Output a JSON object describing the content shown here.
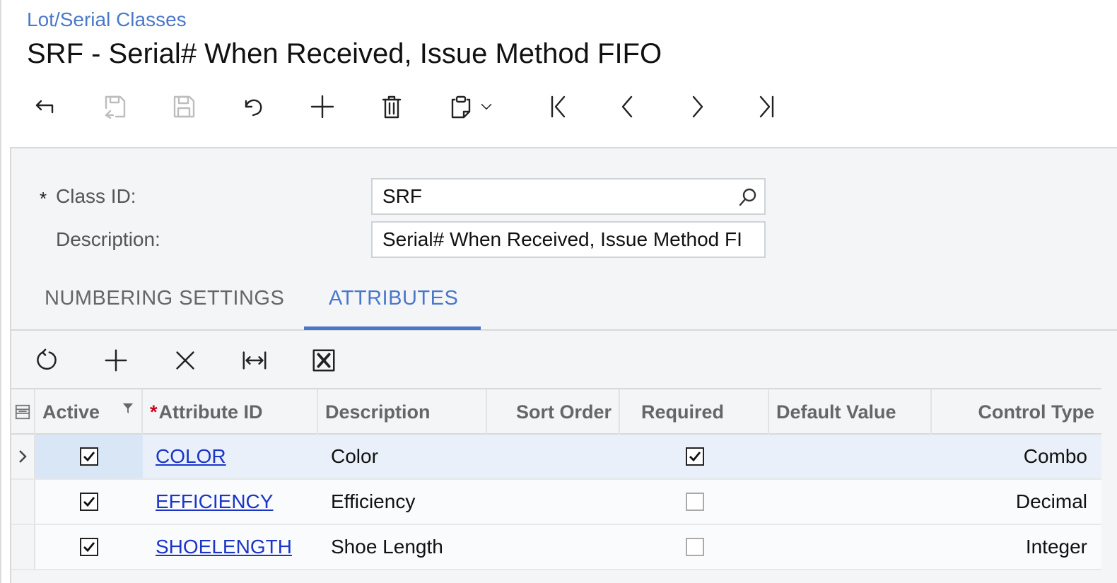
{
  "header": {
    "breadcrumb": "Lot/Serial Classes",
    "title": "SRF - Serial# When Received, Issue Method FIFO"
  },
  "toolbar": {
    "buttons": [
      {
        "name": "back-button",
        "icon": "undo-arrow-icon",
        "enabled": true
      },
      {
        "name": "save-and-close-button",
        "icon": "save-close-icon",
        "enabled": false
      },
      {
        "name": "save-button",
        "icon": "save-icon",
        "enabled": false
      },
      {
        "name": "cancel-button",
        "icon": "revert-icon",
        "enabled": true
      },
      {
        "name": "add-new-button",
        "icon": "plus-icon",
        "enabled": true
      },
      {
        "name": "delete-button",
        "icon": "trash-icon",
        "enabled": true
      },
      {
        "name": "copy-paste-button",
        "icon": "clipboard-icon",
        "enabled": true
      },
      {
        "name": "copy-paste-dropdown",
        "icon": "chevron-down-icon",
        "enabled": true
      },
      {
        "name": "first-record-button",
        "icon": "first-icon",
        "enabled": true
      },
      {
        "name": "previous-record-button",
        "icon": "chevron-left-icon",
        "enabled": true
      },
      {
        "name": "next-record-button",
        "icon": "chevron-right-icon",
        "enabled": true
      },
      {
        "name": "last-record-button",
        "icon": "last-icon",
        "enabled": true
      }
    ]
  },
  "form": {
    "class_id_label": "Class ID:",
    "required_marker": "*",
    "class_id_value": "SRF",
    "description_label": "Description:",
    "description_value": "Serial# When Received, Issue Method FI"
  },
  "tabs": [
    {
      "label": "NUMBERING SETTINGS",
      "active": false
    },
    {
      "label": "ATTRIBUTES",
      "active": true
    }
  ],
  "grid_toolbar": {
    "buttons": [
      "refresh-icon",
      "plus-icon",
      "close-icon",
      "fit-columns-icon",
      "excel-export-icon"
    ]
  },
  "grid": {
    "columns": {
      "active": "Active",
      "attribute_id_required": "*",
      "attribute_id": "Attribute ID",
      "description": "Description",
      "sort_order": "Sort Order",
      "required": "Required",
      "default_value": "Default Value",
      "control_type": "Control Type"
    },
    "rows": [
      {
        "active": true,
        "attribute_id": "COLOR",
        "description": "Color",
        "sort_order": "",
        "required": true,
        "default_value": "",
        "control_type": "Combo"
      },
      {
        "active": true,
        "attribute_id": "EFFICIENCY",
        "description": "Efficiency",
        "sort_order": "",
        "required": false,
        "default_value": "",
        "control_type": "Decimal"
      },
      {
        "active": true,
        "attribute_id": "SHOELENGTH",
        "description": "Shoe Length",
        "sort_order": "",
        "required": false,
        "default_value": "",
        "control_type": "Integer"
      }
    ]
  },
  "colors": {
    "accent": "#4a78c9",
    "link": "#1a35c8",
    "selected_row": "#e9f0f9"
  }
}
